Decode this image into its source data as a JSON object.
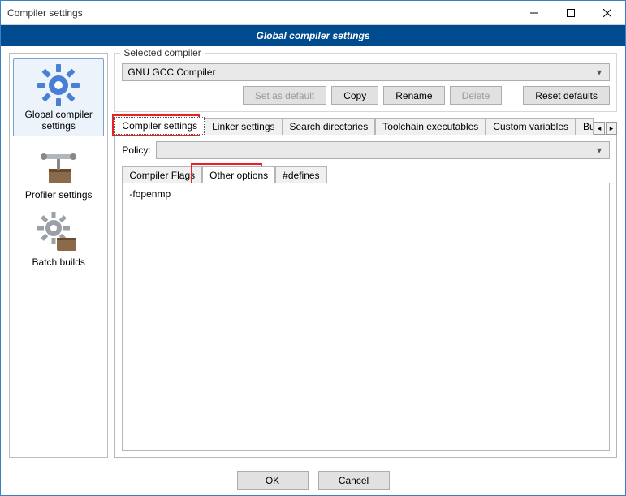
{
  "window": {
    "title": "Compiler settings"
  },
  "header": {
    "title": "Global compiler settings"
  },
  "sidebar": {
    "items": [
      {
        "label": "Global compiler settings"
      },
      {
        "label": "Profiler settings"
      },
      {
        "label": "Batch builds"
      }
    ]
  },
  "selected_compiler": {
    "group_label": "Selected compiler",
    "value": "GNU GCC Compiler",
    "buttons": {
      "set_default": "Set as default",
      "copy": "Copy",
      "rename": "Rename",
      "delete": "Delete",
      "reset": "Reset defaults"
    }
  },
  "tabs": {
    "items": [
      "Compiler settings",
      "Linker settings",
      "Search directories",
      "Toolchain executables",
      "Custom variables",
      "Bui"
    ],
    "active_index": 0
  },
  "policy": {
    "label": "Policy:",
    "value": ""
  },
  "subtabs": {
    "items": [
      "Compiler Flags",
      "Other options",
      "#defines"
    ],
    "active_index": 1
  },
  "other_options": {
    "value": "-fopenmp"
  },
  "footer": {
    "ok": "OK",
    "cancel": "Cancel"
  }
}
